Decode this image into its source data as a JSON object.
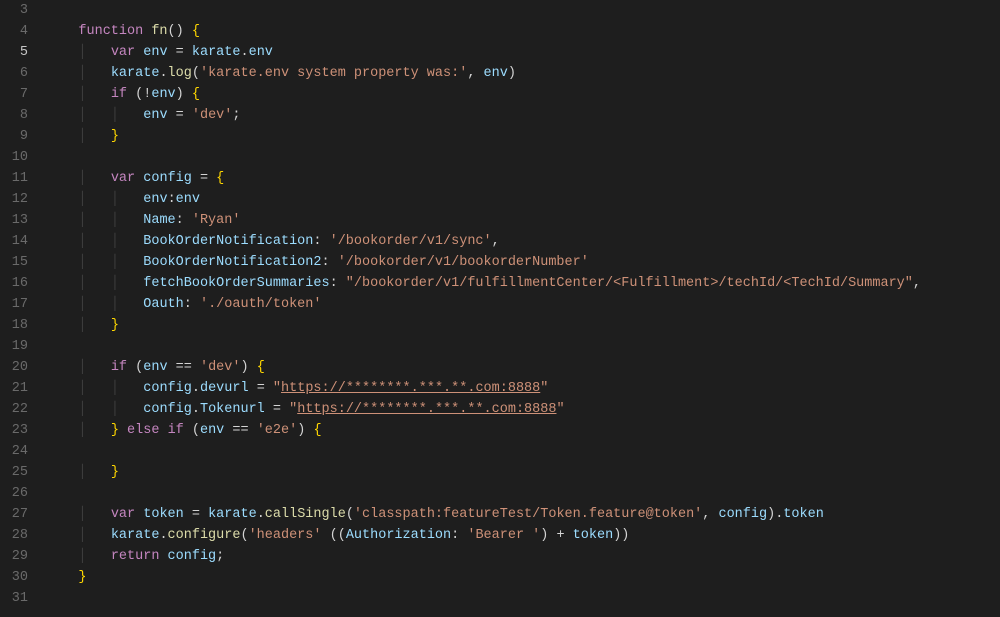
{
  "first_line_number": 3,
  "active_line_number": 5,
  "lines": [
    {
      "tokens": []
    },
    {
      "tokens": [
        {
          "c": "kw",
          "t": "function"
        },
        {
          "c": "plain",
          "t": " "
        },
        {
          "c": "fnname",
          "t": "fn"
        },
        {
          "c": "punct",
          "t": "()"
        },
        {
          "c": "plain",
          "t": " "
        },
        {
          "c": "brace",
          "t": "{"
        }
      ]
    },
    {
      "indent": 1,
      "tokens": [
        {
          "c": "kw",
          "t": "var"
        },
        {
          "c": "plain",
          "t": " "
        },
        {
          "c": "ident",
          "t": "env"
        },
        {
          "c": "plain",
          "t": " = "
        },
        {
          "c": "ident",
          "t": "karate"
        },
        {
          "c": "punct",
          "t": "."
        },
        {
          "c": "ident",
          "t": "env"
        }
      ]
    },
    {
      "indent": 1,
      "tokens": [
        {
          "c": "ident",
          "t": "karate"
        },
        {
          "c": "punct",
          "t": "."
        },
        {
          "c": "fnname",
          "t": "log"
        },
        {
          "c": "punct",
          "t": "("
        },
        {
          "c": "str",
          "t": "'karate.env system property was:'"
        },
        {
          "c": "punct",
          "t": ", "
        },
        {
          "c": "ident",
          "t": "env"
        },
        {
          "c": "punct",
          "t": ")"
        }
      ]
    },
    {
      "indent": 1,
      "tokens": [
        {
          "c": "kw",
          "t": "if"
        },
        {
          "c": "plain",
          "t": " "
        },
        {
          "c": "punct",
          "t": "(!"
        },
        {
          "c": "ident",
          "t": "env"
        },
        {
          "c": "punct",
          "t": ")"
        },
        {
          "c": "plain",
          "t": " "
        },
        {
          "c": "brace",
          "t": "{"
        }
      ]
    },
    {
      "indent": 2,
      "tokens": [
        {
          "c": "ident",
          "t": "env"
        },
        {
          "c": "plain",
          "t": " = "
        },
        {
          "c": "str",
          "t": "'dev'"
        },
        {
          "c": "punct",
          "t": ";"
        }
      ]
    },
    {
      "indent": 1,
      "tokens": [
        {
          "c": "brace",
          "t": "}"
        }
      ]
    },
    {
      "tokens": []
    },
    {
      "indent": 1,
      "tokens": [
        {
          "c": "kw",
          "t": "var"
        },
        {
          "c": "plain",
          "t": " "
        },
        {
          "c": "ident",
          "t": "config"
        },
        {
          "c": "plain",
          "t": " = "
        },
        {
          "c": "brace",
          "t": "{"
        }
      ]
    },
    {
      "indent": 2,
      "tokens": [
        {
          "c": "ident",
          "t": "env"
        },
        {
          "c": "punct",
          "t": ":"
        },
        {
          "c": "ident",
          "t": "env"
        }
      ]
    },
    {
      "indent": 2,
      "tokens": [
        {
          "c": "ident",
          "t": "Name"
        },
        {
          "c": "punct",
          "t": ": "
        },
        {
          "c": "str",
          "t": "'Ryan'"
        }
      ]
    },
    {
      "indent": 2,
      "tokens": [
        {
          "c": "ident",
          "t": "BookOrderNotification"
        },
        {
          "c": "punct",
          "t": ": "
        },
        {
          "c": "str",
          "t": "'/bookorder/v1/sync'"
        },
        {
          "c": "punct",
          "t": ","
        }
      ]
    },
    {
      "indent": 2,
      "tokens": [
        {
          "c": "ident",
          "t": "BookOrderNotification2"
        },
        {
          "c": "punct",
          "t": ": "
        },
        {
          "c": "str",
          "t": "'/bookorder/v1/bookorderNumber'"
        }
      ]
    },
    {
      "indent": 2,
      "tokens": [
        {
          "c": "ident",
          "t": "fetchBookOrderSummaries"
        },
        {
          "c": "punct",
          "t": ": "
        },
        {
          "c": "str",
          "t": "\"/bookorder/v1/fulfillmentCenter/<Fulfillment>/techId/<TechId/Summary\""
        },
        {
          "c": "punct",
          "t": ","
        }
      ]
    },
    {
      "indent": 2,
      "tokens": [
        {
          "c": "ident",
          "t": "Oauth"
        },
        {
          "c": "punct",
          "t": ": "
        },
        {
          "c": "str",
          "t": "'./oauth/token'"
        }
      ]
    },
    {
      "indent": 1,
      "tokens": [
        {
          "c": "brace",
          "t": "}"
        }
      ]
    },
    {
      "tokens": []
    },
    {
      "indent": 1,
      "tokens": [
        {
          "c": "kw",
          "t": "if"
        },
        {
          "c": "plain",
          "t": " "
        },
        {
          "c": "punct",
          "t": "("
        },
        {
          "c": "ident",
          "t": "env"
        },
        {
          "c": "plain",
          "t": " == "
        },
        {
          "c": "str",
          "t": "'dev'"
        },
        {
          "c": "punct",
          "t": ")"
        },
        {
          "c": "plain",
          "t": " "
        },
        {
          "c": "brace",
          "t": "{"
        }
      ]
    },
    {
      "indent": 2,
      "tokens": [
        {
          "c": "ident",
          "t": "config"
        },
        {
          "c": "punct",
          "t": "."
        },
        {
          "c": "ident",
          "t": "dev"
        },
        {
          "c": "ident",
          "t": "url"
        },
        {
          "c": "plain",
          "t": " = "
        },
        {
          "c": "str",
          "t": "\""
        },
        {
          "c": "url",
          "t": "https://********.***.**.com:8888"
        },
        {
          "c": "str",
          "t": "\""
        }
      ]
    },
    {
      "indent": 2,
      "tokens": [
        {
          "c": "ident",
          "t": "config"
        },
        {
          "c": "punct",
          "t": "."
        },
        {
          "c": "ident",
          "t": "Token"
        },
        {
          "c": "ident",
          "t": "url"
        },
        {
          "c": "plain",
          "t": " = "
        },
        {
          "c": "str",
          "t": "\""
        },
        {
          "c": "url",
          "t": "https://********.***.**.com:8888"
        },
        {
          "c": "str",
          "t": "\""
        }
      ]
    },
    {
      "indent": 1,
      "tokens": [
        {
          "c": "brace",
          "t": "}"
        },
        {
          "c": "plain",
          "t": " "
        },
        {
          "c": "kw",
          "t": "else"
        },
        {
          "c": "plain",
          "t": " "
        },
        {
          "c": "kw",
          "t": "if"
        },
        {
          "c": "plain",
          "t": " "
        },
        {
          "c": "punct",
          "t": "("
        },
        {
          "c": "ident",
          "t": "env"
        },
        {
          "c": "plain",
          "t": " == "
        },
        {
          "c": "str",
          "t": "'e2e'"
        },
        {
          "c": "punct",
          "t": ")"
        },
        {
          "c": "plain",
          "t": " "
        },
        {
          "c": "brace",
          "t": "{"
        }
      ]
    },
    {
      "tokens": []
    },
    {
      "indent": 1,
      "tokens": [
        {
          "c": "brace",
          "t": "}"
        }
      ]
    },
    {
      "tokens": []
    },
    {
      "indent": 1,
      "tokens": [
        {
          "c": "kw",
          "t": "var"
        },
        {
          "c": "plain",
          "t": " "
        },
        {
          "c": "ident",
          "t": "token"
        },
        {
          "c": "plain",
          "t": " = "
        },
        {
          "c": "ident",
          "t": "karate"
        },
        {
          "c": "punct",
          "t": "."
        },
        {
          "c": "fnname",
          "t": "callSingle"
        },
        {
          "c": "punct",
          "t": "("
        },
        {
          "c": "str",
          "t": "'classpath:featureTest/Token.feature@token'"
        },
        {
          "c": "punct",
          "t": ", "
        },
        {
          "c": "ident",
          "t": "config"
        },
        {
          "c": "punct",
          "t": ")."
        },
        {
          "c": "ident",
          "t": "token"
        }
      ]
    },
    {
      "indent": 1,
      "tokens": [
        {
          "c": "ident",
          "t": "karate"
        },
        {
          "c": "punct",
          "t": "."
        },
        {
          "c": "fnname",
          "t": "configure"
        },
        {
          "c": "punct",
          "t": "("
        },
        {
          "c": "str",
          "t": "'headers'"
        },
        {
          "c": "plain",
          "t": " "
        },
        {
          "c": "punct",
          "t": "(("
        },
        {
          "c": "ident",
          "t": "Authorization"
        },
        {
          "c": "punct",
          "t": ": "
        },
        {
          "c": "str",
          "t": "'Bearer '"
        },
        {
          "c": "punct",
          "t": ") + "
        },
        {
          "c": "ident",
          "t": "token"
        },
        {
          "c": "punct",
          "t": "))"
        }
      ]
    },
    {
      "indent": 1,
      "tokens": [
        {
          "c": "kw",
          "t": "return"
        },
        {
          "c": "plain",
          "t": " "
        },
        {
          "c": "ident",
          "t": "config"
        },
        {
          "c": "punct",
          "t": ";"
        }
      ]
    },
    {
      "tokens": [
        {
          "c": "brace",
          "t": "}"
        }
      ]
    },
    {
      "tokens": []
    }
  ],
  "fold_markers": {
    "4": true,
    "30": true
  },
  "indent_guides": true
}
